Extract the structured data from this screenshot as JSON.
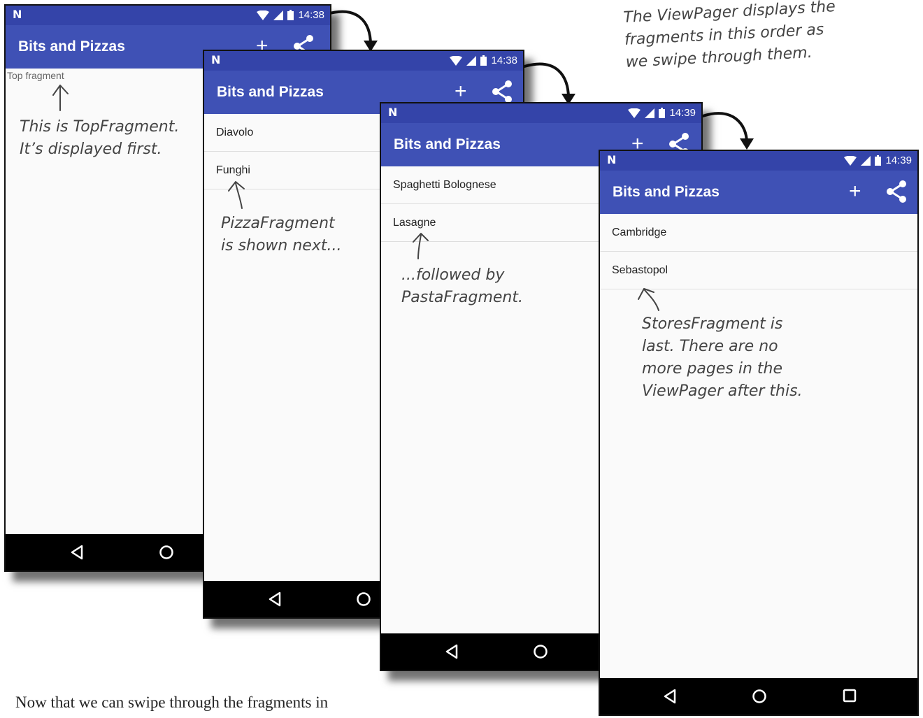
{
  "phones": [
    {
      "time": "14:38",
      "app_title": "Bits and Pizzas",
      "content_text": "Top fragment",
      "items": []
    },
    {
      "time": "14:38",
      "app_title": "Bits and Pizzas",
      "items": [
        "Diavolo",
        "Funghi"
      ]
    },
    {
      "time": "14:39",
      "app_title": "Bits and Pizzas",
      "items": [
        "Spaghetti Bolognese",
        "Lasagne"
      ]
    },
    {
      "time": "14:39",
      "app_title": "Bits and Pizzas",
      "items": [
        "Cambridge",
        "Sebastopol"
      ]
    }
  ],
  "annotations": {
    "viewpager_order": "The ViewPager displays the\nfragments in this order as\nwe swipe through them.",
    "top_fragment": "This is TopFragment.\nIt’s displayed first.",
    "pizza_fragment": "PizzaFragment\nis shown next...",
    "pasta_fragment": "...followed by\nPastaFragment.",
    "stores_fragment": "StoresFragment is\nlast. There are no\nmore pages in the\nViewPager after this."
  },
  "body_text": "Now that we can swipe through the fragments in",
  "icons": {
    "status": [
      "android-n-icon",
      "wifi-icon",
      "signal-icon",
      "battery-icon"
    ],
    "appbar": [
      "plus-icon",
      "share-icon"
    ],
    "navbar": [
      "back-icon",
      "home-icon",
      "recents-icon"
    ]
  },
  "colors": {
    "status_bar": "#3444a9",
    "app_bar": "#3f51b5",
    "screen_bg": "#fafafa",
    "nav_bar": "#000000"
  }
}
